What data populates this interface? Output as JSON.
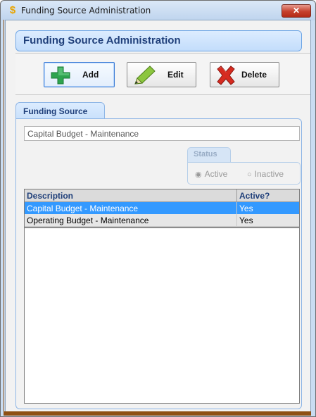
{
  "window": {
    "title": "Funding Source Administration",
    "close_label": "✕"
  },
  "header": {
    "title": "Funding Source Administration"
  },
  "toolbar": {
    "add_label": "Add",
    "edit_label": "Edit",
    "delete_label": "Delete"
  },
  "tab": {
    "label": "Funding Source"
  },
  "form": {
    "description_value": "Capital Budget - Maintenance"
  },
  "status": {
    "label": "Status",
    "options": [
      "Active",
      "Inactive"
    ],
    "selected": "Active"
  },
  "grid": {
    "columns": [
      "Description",
      "Active?"
    ],
    "rows": [
      [
        "Capital Budget - Maintenance",
        "Yes"
      ],
      [
        "Operating Budget - Maintenance",
        "Yes"
      ]
    ],
    "selected_row": 0
  },
  "colors": {
    "selection": "#3399ff",
    "header_text": "#1f3f7a",
    "add_icon": "#2ea44f",
    "edit_icon": "#8cc63f",
    "delete_icon": "#d62b20"
  },
  "icons": {
    "title": "dollar-icon",
    "add": "plus-icon",
    "edit": "pencil-icon",
    "delete": "x-icon"
  }
}
